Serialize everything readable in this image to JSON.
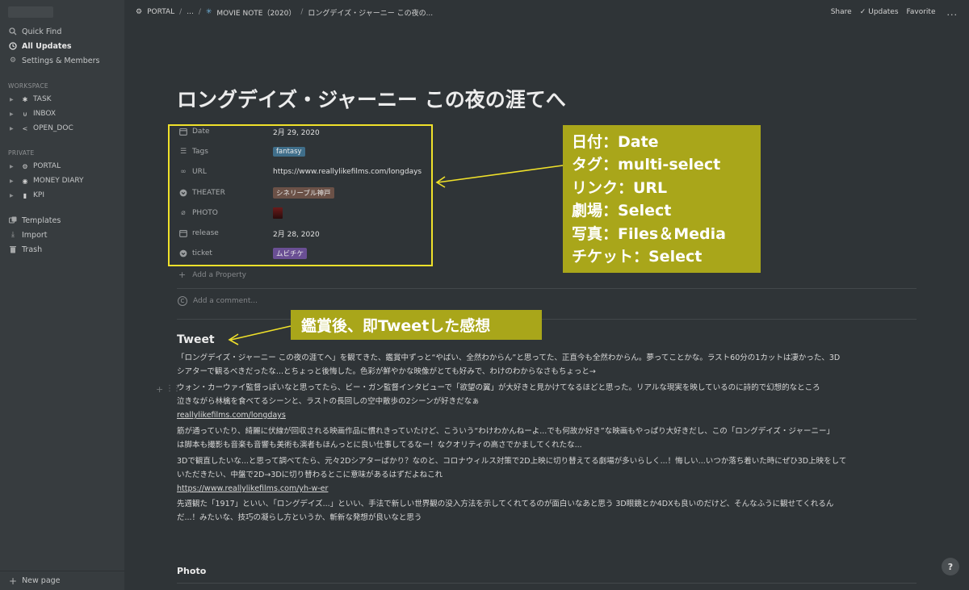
{
  "sidebar": {
    "top": [
      {
        "label": "Quick Find",
        "icon": "search-icon"
      },
      {
        "label": "All Updates",
        "icon": "clock-icon"
      },
      {
        "label": "Settings & Members",
        "icon": "gear-icon"
      }
    ],
    "workspace_heading": "WORKSPACE",
    "workspace_pages": [
      {
        "label": "TASK",
        "icon": "asterisk-icon"
      },
      {
        "label": "INBOX",
        "icon": "inbox-icon"
      },
      {
        "label": "OPEN_DOC",
        "icon": "share-icon"
      }
    ],
    "private_heading": "PRIVATE",
    "private_pages": [
      {
        "label": "PORTAL",
        "icon": "gear-icon"
      },
      {
        "label": "MONEY DIARY",
        "icon": "coins-icon"
      },
      {
        "label": "KPI",
        "icon": "chart-icon"
      }
    ],
    "bottom": [
      {
        "label": "Templates",
        "icon": "templates-icon"
      },
      {
        "label": "Import",
        "icon": "download-icon"
      },
      {
        "label": "Trash",
        "icon": "trash-icon"
      }
    ],
    "new_page": "New page"
  },
  "breadcrumb": {
    "root": "PORTAL",
    "ellipsis": "...",
    "parent": "MOVIE NOTE（2020）",
    "current": "ロングデイズ・ジャーニー この夜の..."
  },
  "topbar": {
    "share": "Share",
    "updates": "Updates",
    "favorite": "Favorite",
    "more": "..."
  },
  "page": {
    "title": "ロングデイズ・ジャーニー この夜の涯てへ",
    "properties": [
      {
        "name": "Date",
        "icon": "calendar-icon",
        "value": "2月 29, 2020",
        "kind": "text"
      },
      {
        "name": "Tags",
        "icon": "list-icon",
        "value": "fantasy",
        "kind": "tag-blue"
      },
      {
        "name": "URL",
        "icon": "link-icon",
        "value": "https://www.reallylikefilms.com/longdays",
        "kind": "text"
      },
      {
        "name": "THEATER",
        "icon": "select-icon",
        "value": "シネリーブル神戸",
        "kind": "tag-brown"
      },
      {
        "name": "PHOTO",
        "icon": "paperclip-icon",
        "value": "",
        "kind": "photo"
      },
      {
        "name": "release",
        "icon": "calendar-icon",
        "value": "2月 28, 2020",
        "kind": "text"
      },
      {
        "name": "ticket",
        "icon": "select-icon",
        "value": "ムビチケ",
        "kind": "tag-purple"
      }
    ],
    "add_property": "Add a Property",
    "add_comment": "Add a comment...",
    "tweet_heading": "Tweet",
    "paragraphs": [
      {
        "lines": [
          "「ロングデイズ・ジャーニー この夜の涯てへ」を観てきた、鑑賞中ずっと“やばい、全然わからん”と思ってた、正直今も全然わからん。夢ってことかな。ラスト60分の1カットは凄かった、3D",
          "シアターで観るべきだったな...とちょっと後悔した。色彩が鮮やかな映像がとても好みで、わけのわからなさもちょっと→"
        ],
        "link": ""
      },
      {
        "lines": [
          "ウォン・カーウァイ監督っぽいなと思ってたら、ビー・ガン監督インタビューで「欲望の翼」が大好きと見かけてなるほどと思った。リアルな現実を映しているのに詩的で幻想的なところ",
          "泣きながら林檎を食べてるシーンと、ラストの長回しの空中散歩の2シーンが好きだなぁ"
        ],
        "link": "reallylikefilms.com/longdays"
      },
      {
        "lines": [
          "筋が通っていたり、綺麗に伏線が回収される映画作品に慣れきっていたけど、こういう“わけわかんねーよ...でも何故か好き”な映画もやっぱり大好きだし、この「ロングデイズ・ジャーニー」",
          "は脚本も撮影も音楽も音響も美術も演者もほんっとに良い仕事してるなー！なクオリティの高さでかましてくれたな..."
        ],
        "link": ""
      },
      {
        "lines": [
          "3Dで観直したいな...と思って調べてたら、元々2Dシアターばかり？なのと、コロナウィルス対策で2D上映に切り替えてる劇場が多いらしく...！悔しい...いつか落ち着いた時にぜひ3D上映をして",
          "いただきたい、中盤で2D→3Dに切り替わるとこに意味があるはずだよねこれ"
        ],
        "link": "https://www.reallylikefilms.com/yh-w-er"
      },
      {
        "lines": [
          "先週観た「1917」といい、「ロングデイズ...」といい、手法で新しい世界観の没入方法を示してくれてるのが面白いなあと思う 3D眼鏡とか4DXも良いのだけど、そんなふうに観せてくれるん",
          "だ...！みたいな、技巧の凝らし方というか、斬新な発想が良いなと思う"
        ],
        "link": ""
      }
    ],
    "photo_heading": "Photo"
  },
  "annotations": {
    "main_lines": [
      "日付：Date",
      "タグ：multi-select",
      "リンク：URL",
      "劇場：Select",
      "写真：Files＆Media",
      "チケット：Select"
    ],
    "tweet_note": "鑑賞後、即Tweetした感想"
  },
  "help": "?",
  "colors": {
    "background": "#2f3437",
    "sidebar": "#373c3f",
    "annotation_fill": "#a9a61a",
    "annotation_border": "#f0e12a",
    "tag_blue": "#3f6e8a",
    "tag_brown": "#6b5147",
    "tag_purple": "#6a4f94"
  }
}
